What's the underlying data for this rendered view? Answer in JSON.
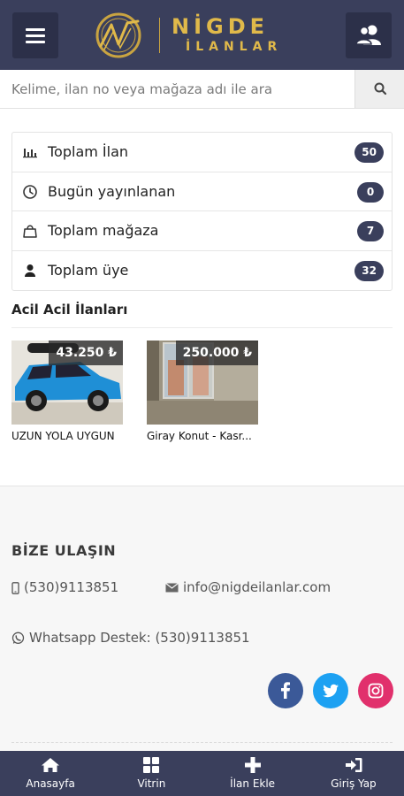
{
  "header": {
    "brand_line1": "NİGDE",
    "brand_line2": "İLANLAR",
    "menu_icon": "hamburger-menu-icon",
    "user_icon": "users-icon"
  },
  "search": {
    "placeholder": "Kelime, ilan no veya mağaza adı ile ara",
    "button_icon": "search-icon"
  },
  "stats": [
    {
      "icon": "bar-chart-icon",
      "label": "Toplam İlan",
      "count": "50"
    },
    {
      "icon": "clock-icon",
      "label": "Bugün yayınlanan",
      "count": "0"
    },
    {
      "icon": "shopping-bag-icon",
      "label": "Toplam mağaza",
      "count": "7"
    },
    {
      "icon": "user-icon",
      "label": "Toplam üye",
      "count": "32"
    }
  ],
  "urgent": {
    "title": "Acil Acil İlanları",
    "items": [
      {
        "price": "43.250 ₺",
        "title": "UZUN YOLA UYGUN"
      },
      {
        "price": "250.000 ₺",
        "title": "Giray Konut - Kasr..."
      }
    ]
  },
  "contact": {
    "title": "BİZE ULAŞIN",
    "phone": "(530)9113851",
    "email": "info@nigdeilanlar.com",
    "whatsapp": "Whatsapp Destek: (530)9113851",
    "social": [
      {
        "icon": "facebook-icon",
        "color": "#3b5998"
      },
      {
        "icon": "twitter-icon",
        "color": "#1da1f2"
      },
      {
        "icon": "instagram-icon",
        "color": "#e1306c"
      }
    ]
  },
  "bottom_nav": [
    {
      "icon": "home-icon",
      "label": "Anasayfa"
    },
    {
      "icon": "grid-icon",
      "label": "Vitrin"
    },
    {
      "icon": "plus-icon",
      "label": "İlan Ekle"
    },
    {
      "icon": "sign-in-icon",
      "label": "Giriş Yap"
    }
  ],
  "colors": {
    "primary": "#3a3f5c",
    "gold": "#e0b94a"
  }
}
